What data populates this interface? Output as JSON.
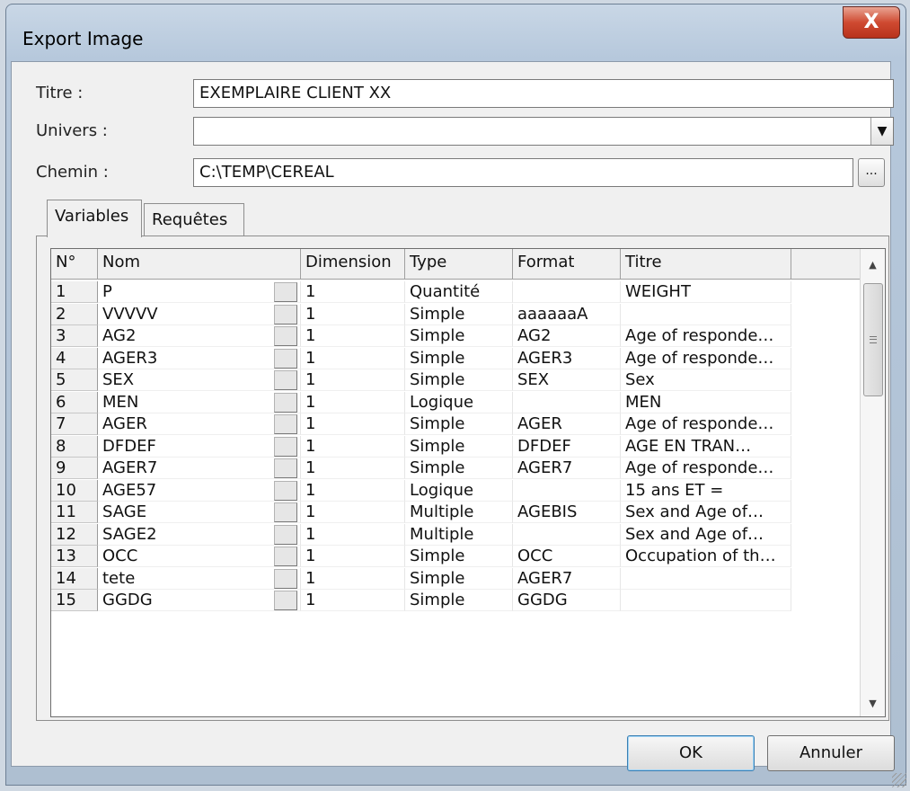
{
  "window": {
    "title": "Export Image",
    "close_label": "X"
  },
  "fields": {
    "titre_label": "Titre :",
    "titre_value": "EXEMPLAIRE CLIENT XX",
    "univers_label": "Univers :",
    "univers_value": "",
    "chemin_label": "Chemin :",
    "chemin_value": "C:\\TEMP\\CEREAL",
    "browse_label": "..."
  },
  "tabs": [
    {
      "label": "Variables",
      "active": true
    },
    {
      "label": "Requêtes",
      "active": false
    }
  ],
  "table": {
    "headers": [
      "N°",
      "Nom",
      "Dimension",
      "Type",
      "Format",
      "Titre"
    ],
    "rows": [
      [
        "1",
        "P",
        "1",
        "Quantité",
        "",
        "WEIGHT"
      ],
      [
        "2",
        "VVVVV",
        "1",
        "Simple",
        "aaaaaaA",
        ""
      ],
      [
        "3",
        "AG2",
        "1",
        "Simple",
        "AG2",
        "Age of responde…"
      ],
      [
        "4",
        "AGER3",
        "1",
        "Simple",
        "AGER3",
        "Age of responde…"
      ],
      [
        "5",
        "SEX",
        "1",
        "Simple",
        "SEX",
        "Sex"
      ],
      [
        "6",
        "MEN",
        "1",
        "Logique",
        "",
        "MEN"
      ],
      [
        "7",
        "AGER",
        "1",
        "Simple",
        "AGER",
        "Age of responde…"
      ],
      [
        "8",
        "DFDEF",
        "1",
        "Simple",
        "DFDEF",
        "AGE EN TRAN…"
      ],
      [
        "9",
        "AGER7",
        "1",
        "Simple",
        "AGER7",
        "Age of responde…"
      ],
      [
        "10",
        "AGE57",
        "1",
        "Logique",
        "",
        "15 ans ET ="
      ],
      [
        "11",
        "SAGE",
        "1",
        "Multiple",
        "AGEBIS",
        "Sex and Age of…"
      ],
      [
        "12",
        "SAGE2",
        "1",
        "Multiple",
        "",
        "Sex and Age of…"
      ],
      [
        "13",
        "OCC",
        "1",
        "Simple",
        "OCC",
        "Occupation of th…"
      ],
      [
        "14",
        "tete",
        "1",
        "Simple",
        "AGER7",
        ""
      ],
      [
        "15",
        "GGDG",
        "1",
        "Simple",
        "GGDG",
        ""
      ]
    ]
  },
  "buttons": {
    "ok": "OK",
    "cancel": "Annuler"
  },
  "icons": {
    "close": "close-icon",
    "combo_arrow": "chevron-down-icon",
    "scroll_up": "scroll-up-arrow",
    "scroll_down": "scroll-down-arrow"
  }
}
